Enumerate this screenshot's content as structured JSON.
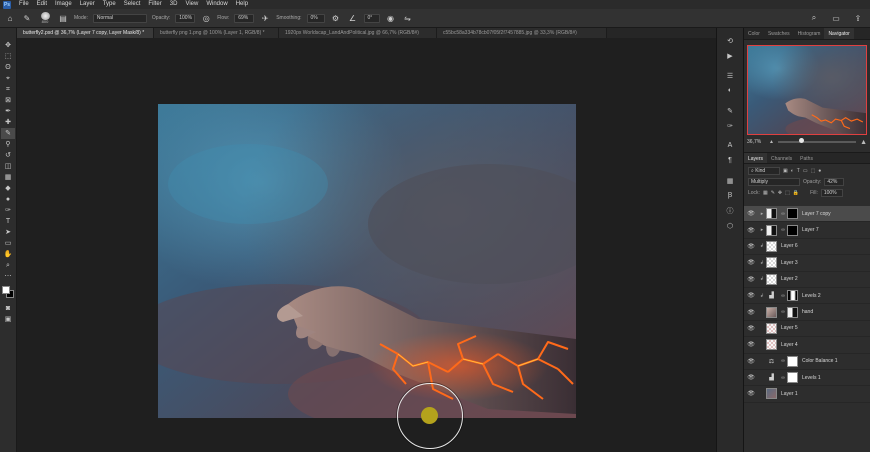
{
  "menubar": {
    "app_logo": "Ps",
    "items": [
      "File",
      "Edit",
      "Image",
      "Layer",
      "Type",
      "Select",
      "Filter",
      "3D",
      "View",
      "Window",
      "Help"
    ]
  },
  "options": {
    "brush_size": "800",
    "mode_label": "Mode:",
    "mode_value": "Normal",
    "opacity_label": "Opacity:",
    "opacity_value": "100%",
    "flow_label": "Flow:",
    "flow_value": "69%",
    "smoothing_label": "Smoothing:",
    "smoothing_value": "0%",
    "angle_value": "0°"
  },
  "tabs": [
    {
      "label": "butterfly2.psd @ 36,7% (Layer 7 copy, Layer Mask/8) *",
      "active": true
    },
    {
      "label": "butterfly png 1.png @ 100% (Layer 1, RGB/8) *",
      "active": false
    },
    {
      "label": "1920px Worldscap_LandAndPolitical.jpg @ 66,7% (RGB/8#)",
      "active": false
    },
    {
      "label": "c55bc58a334b78cb07f05f2f7457885.jpg @ 33,3% (RGB/8#)",
      "active": false
    }
  ],
  "panel_tabs": [
    {
      "label": "Color",
      "active": false
    },
    {
      "label": "Swatches",
      "active": false
    },
    {
      "label": "Histogram",
      "active": false
    },
    {
      "label": "Navigator",
      "active": true
    }
  ],
  "navigator": {
    "zoom": "36,7%",
    "zoom_fraction": 0.3
  },
  "layers_tabs": [
    {
      "label": "Layers",
      "active": true
    },
    {
      "label": "Channels",
      "active": false
    },
    {
      "label": "Paths",
      "active": false
    }
  ],
  "layers_controls": {
    "kind": "Kind",
    "blend_mode": "Multiply",
    "opacity_label": "Opacity:",
    "opacity_value": "42%",
    "lock_label": "Lock:",
    "fill_label": "Fill:",
    "fill_value": "100%"
  },
  "layers": [
    {
      "name": "Layer 7 copy",
      "selected": true,
      "thumb": "black",
      "mask": true
    },
    {
      "name": "Layer 7",
      "selected": false,
      "thumb": "black",
      "mask": true
    },
    {
      "name": "Layer 6",
      "selected": false,
      "thumb": "checker",
      "mask": false
    },
    {
      "name": "Layer 3",
      "selected": false,
      "thumb": "checker",
      "mask": false
    },
    {
      "name": "Layer 2",
      "selected": false,
      "thumb": "checker",
      "mask": false
    },
    {
      "name": "Levels 2",
      "selected": false,
      "thumb": "adjust",
      "mask": true
    },
    {
      "name": "hand",
      "selected": false,
      "thumb": "hand",
      "mask": true
    },
    {
      "name": "Layer 5",
      "selected": false,
      "thumb": "redtex",
      "mask": false
    },
    {
      "name": "Layer 4",
      "selected": false,
      "thumb": "redtex",
      "mask": false
    },
    {
      "name": "Color Balance 1",
      "selected": false,
      "thumb": "adjust",
      "mask": true
    },
    {
      "name": "Levels 1",
      "selected": false,
      "thumb": "adjust",
      "mask": true
    },
    {
      "name": "Layer 1",
      "selected": false,
      "thumb": "dark",
      "mask": false
    }
  ],
  "colors": {
    "accent": "#2a5ea8",
    "brush_center": "#b4a21c",
    "navigator_frame": "#e04040",
    "selected_layer": "#4b4b4b"
  }
}
